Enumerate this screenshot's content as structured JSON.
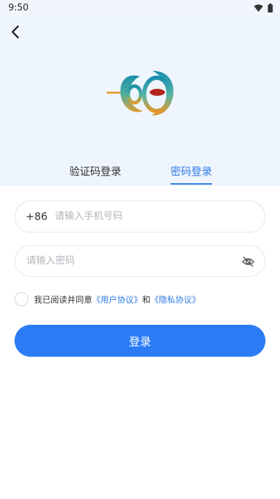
{
  "status": {
    "time": "9:50"
  },
  "tabs": [
    {
      "label": "验证码登录",
      "active": false
    },
    {
      "label": "密码登录",
      "active": true
    }
  ],
  "phone": {
    "country_code": "+86",
    "placeholder": "请输入手机号码",
    "value": ""
  },
  "password": {
    "placeholder": "请输入密码",
    "value": ""
  },
  "agreement": {
    "prefix": "我已阅读并同意",
    "user_agreement": "《用户协议》",
    "connector": "和",
    "privacy_agreement": "《隐私协议》"
  },
  "login_button": {
    "label": "登录"
  },
  "colors": {
    "accent": "#2a7cf5",
    "tab_active": "#2d7be5",
    "top_bg": "#eef5fd"
  },
  "icons": [
    "back-arrow-icon",
    "wifi-icon",
    "battery-icon",
    "eye-off-icon",
    "app-logo"
  ]
}
